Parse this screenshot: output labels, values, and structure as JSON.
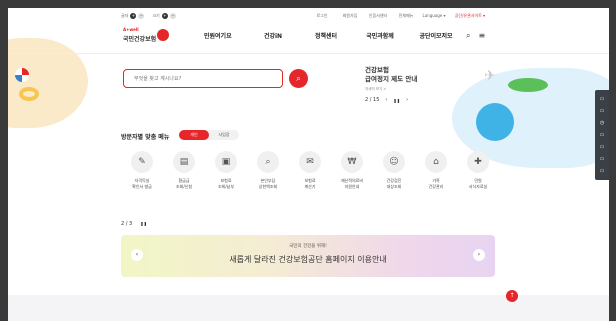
{
  "util": {
    "font_label": "글자",
    "zoom_label": "크기",
    "plus": "+",
    "minus": "−",
    "links": [
      "로그인",
      "회원가입",
      "인증서센터",
      "전체메뉴",
      "Language ▾",
      "공단/유관사이트 ▾"
    ]
  },
  "logo": {
    "small": "A+well",
    "main": "국민건강보험"
  },
  "gnb": [
    "민원여기요",
    "건강iN",
    "정책센터",
    "국민과함께",
    "공단이모저모"
  ],
  "search": {
    "placeholder": "무엇을 찾고 계시나요?"
  },
  "promo": {
    "line1": "건강보험",
    "line2": "급여정지 제도 안내",
    "sub": "자세히 보기 >",
    "page": "2 / 15",
    "prev": "‹",
    "pause": "❚❚",
    "next": "›"
  },
  "menu": {
    "title": "방문자별 맞춤 메뉴",
    "tabs": [
      {
        "label": "개인",
        "active": true
      },
      {
        "label": "사업장",
        "active": false
      }
    ],
    "items": [
      {
        "icon": "✎",
        "l1": "자격득실",
        "l2": "확인서 발급"
      },
      {
        "icon": "▤",
        "l1": "환급금",
        "l2": "조회/신청"
      },
      {
        "icon": "▣",
        "l1": "보험료",
        "l2": "조회/납부"
      },
      {
        "icon": "⌕",
        "l1": "본인부담",
        "l2": "상한액조회"
      },
      {
        "icon": "✉",
        "l1": "보험료",
        "l2": "계산기"
      },
      {
        "icon": "₩",
        "l1": "재난적의료비",
        "l2": "지원안내"
      },
      {
        "icon": "☺",
        "l1": "건강검진",
        "l2": "대상조회"
      },
      {
        "icon": "⌂",
        "l1": "가족",
        "l2": "건강관리"
      },
      {
        "icon": "✚",
        "l1": "민원",
        "l2": "서식자료실"
      }
    ]
  },
  "pager2": {
    "page": "2 / 3",
    "pause": "❚❚"
  },
  "banner": {
    "line1": "국민의 건강을 위해!",
    "line2": "새롭게 달라진 건강보험공단 홈페이지 이용안내",
    "prev": "‹",
    "next": "›"
  },
  "top_button": "↑",
  "side_icons": [
    "▭",
    "▭",
    "◷",
    "▭",
    "▭",
    "▭",
    "▭"
  ],
  "colors": {
    "brand": "#e5262a",
    "banner_start": "#f2f6c6",
    "banner_end": "#e8d4f2"
  }
}
